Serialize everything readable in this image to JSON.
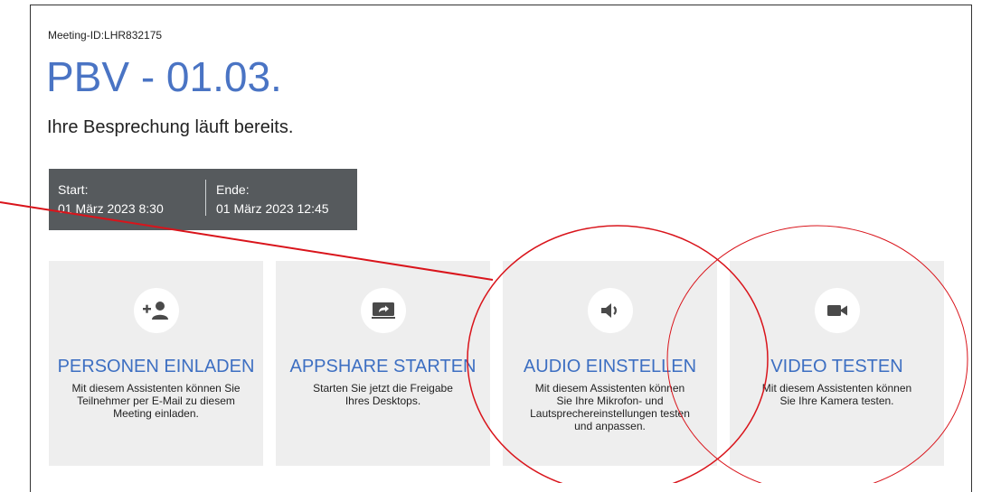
{
  "meeting": {
    "id_label": "Meeting-ID:LHR832175",
    "title": "PBV - 01.03.",
    "status": "Ihre Besprechung läuft bereits."
  },
  "schedule": {
    "start_label": "Start:",
    "start_value": "01 März 2023 8:30",
    "end_label": "Ende:",
    "end_value": "01 März 2023 12:45"
  },
  "tiles": [
    {
      "icon": "add-person-icon",
      "title": "PERSONEN EINLADEN",
      "description": "Mit diesem Assistenten können Sie Teilnehmer per E-Mail zu diesem Meeting einladen."
    },
    {
      "icon": "screen-share-icon",
      "title": "APPSHARE STARTEN",
      "description": "Starten Sie jetzt die Freigabe Ihres Desktops."
    },
    {
      "icon": "speaker-icon",
      "title": "AUDIO EINSTELLEN",
      "description": "Mit diesem Assistenten können Sie Ihre Mikrofon- und Lautsprechereinstellungen testen und anpassen."
    },
    {
      "icon": "video-camera-icon",
      "title": "VIDEO TESTEN",
      "description": "Mit diesem Assistenten können Sie Ihre Kamera testen."
    }
  ],
  "colors": {
    "accent": "#3d6fc2",
    "title": "#4a74c4",
    "time_box": "#565a5d",
    "tile_bg": "#eeeeee",
    "annotation": "#d9141b"
  }
}
